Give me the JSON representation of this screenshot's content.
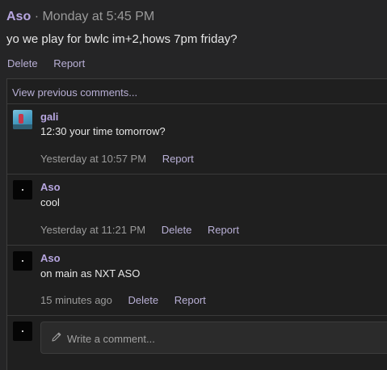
{
  "post": {
    "author": "Aso",
    "separator": "·",
    "time": "Monday at 5:45 PM",
    "body": "yo we play for bwlc im+2,hows 7pm friday?",
    "delete_label": "Delete",
    "report_label": "Report"
  },
  "thread": {
    "view_previous_label": "View previous comments...",
    "comments": [
      {
        "author": "gali",
        "text": "12:30 your time tomorrow?",
        "time": "Yesterday at 10:57 PM",
        "report_label": "Report"
      },
      {
        "author": "Aso",
        "text": "cool",
        "time": "Yesterday at 11:21 PM",
        "delete_label": "Delete",
        "report_label": "Report"
      },
      {
        "author": "Aso",
        "text": "on main as NXT ASO",
        "time": "15 minutes ago",
        "delete_label": "Delete",
        "report_label": "Report"
      }
    ],
    "composer_placeholder": "Write a comment..."
  },
  "colors": {
    "background": "#252526",
    "author_accent": "#b7a6e0",
    "link": "#b9b0d6",
    "muted": "#9a9a9a"
  },
  "icons": {
    "composer": "pencil-icon"
  }
}
